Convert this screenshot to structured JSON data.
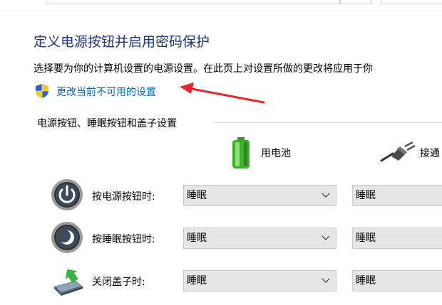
{
  "page": {
    "title": "定义电源按钮并启用密码保护",
    "description": "选择要为你的计算机设置的电源设置。在此页上对设置所做的更改将应用于你",
    "change_link": "更改当前不可用的设置"
  },
  "group": {
    "label": "电源按钮、睡眠按钮和盖子设置"
  },
  "columns": {
    "battery": "用电池",
    "plugged_in": "接通"
  },
  "rows": [
    {
      "label": "按电源按钮时:",
      "battery": "睡眠",
      "plugged_in": "睡眠"
    },
    {
      "label": "按睡眠按钮时:",
      "battery": "睡眠",
      "plugged_in": "睡眠"
    },
    {
      "label": "关闭盖子时:",
      "battery": "睡眠",
      "plugged_in": "睡眠"
    }
  ],
  "colors": {
    "title": "#1e3287",
    "link": "#0066cc",
    "annotation_arrow": "#e8262a"
  }
}
